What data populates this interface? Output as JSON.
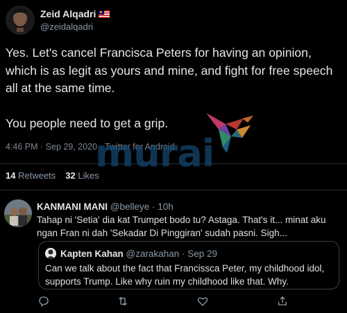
{
  "main_tweet": {
    "author_name": "Zeid Alqadri",
    "author_handle": "@zeidalqadri",
    "text": "Yes. Let's cancel Francisca Peters for having an opinion, which is as legit as yours and mine, and fight for free speech all at the same time.\n\nYou people need to get a grip.",
    "time": "4:46 PM",
    "date": "Sep 29, 2020",
    "source": "Twitter for Android",
    "separator": " · ",
    "retweets_count": "14",
    "retweets_label": "Retweets",
    "likes_count": "32",
    "likes_label": "Likes"
  },
  "watermark": {
    "text": "murai"
  },
  "reply": {
    "author_name": "KANMANI MANI",
    "author_handle": "@belleye",
    "separator": " · ",
    "time_ago": "10h",
    "text": "Tahap ni 'Setia' dia kat Trumpet bodo tu? Astaga. That's it... minat aku ngan Fran ni dah 'Sekadar Di Pinggiran' sudah pasni. Sigh...",
    "quote": {
      "author_name": "Kapten Kahan",
      "author_handle": "@zarakahan",
      "separator": " · ",
      "date": "Sep 29",
      "text": "Can we talk about the fact that Francissca Peter, my childhood idol, supports Trump. Like why ruin my childhood like that. Why."
    },
    "actions": {
      "reply_icon": "comment-icon",
      "retweet_icon": "retweet-icon",
      "like_icon": "heart-icon",
      "share_icon": "share-icon"
    }
  },
  "colors": {
    "background": "#000000",
    "text": "#e6e6e6",
    "secondary": "#8b98a5",
    "divider": "#2b2f33",
    "watermark": "#14466e"
  }
}
